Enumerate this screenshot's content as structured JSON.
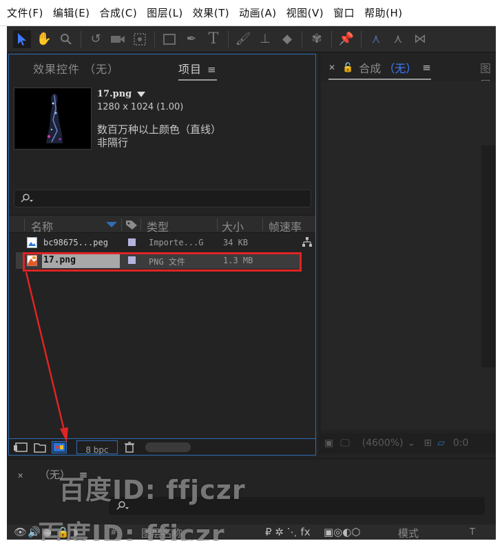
{
  "menu": [
    "文件(F)",
    "编辑(E)",
    "合成(C)",
    "图层(L)",
    "效果(T)",
    "动画(A)",
    "视图(V)",
    "窗口",
    "帮助(H)"
  ],
  "tabs": {
    "effects": "效果控件 （无）",
    "project": "项目",
    "composition": "合成",
    "composition_value": "（无）",
    "layer": "图层"
  },
  "file_info": {
    "name": "17.png",
    "dimensions": "1280 x 1024 (1.00)",
    "colors": "数百万种以上颜色（直线）",
    "interlace": "非隔行"
  },
  "search": {
    "placeholder": ""
  },
  "columns": {
    "name": "名称",
    "type": "类型",
    "size": "大小",
    "fps": "帧速率"
  },
  "files": [
    {
      "name": "bc98675...peg",
      "type": "Importe...G",
      "size": "34 KB"
    },
    {
      "name": "17.png",
      "type": "PNG 文件",
      "size": "1.3 MB"
    }
  ],
  "bottom": {
    "bpc": "8 bpc"
  },
  "viewer": {
    "zoom": "(4600%)",
    "time": "0:0"
  },
  "timeline": {
    "tab": "（无）",
    "layer_name_header": "图层名称",
    "mode_header": "模式",
    "t_header": "T",
    "switch_header": "#",
    "fx_icons": "₽ ✲ ⋱ fx"
  },
  "watermark": {
    "line1": "百度ID: ffjczr",
    "line2": "百度ID: ffjczr"
  },
  "colors": {
    "accent": "#2f6db5",
    "highlight_red": "#e02424",
    "active_tool": "#3d7bff",
    "swatch": "#b3b3de"
  }
}
